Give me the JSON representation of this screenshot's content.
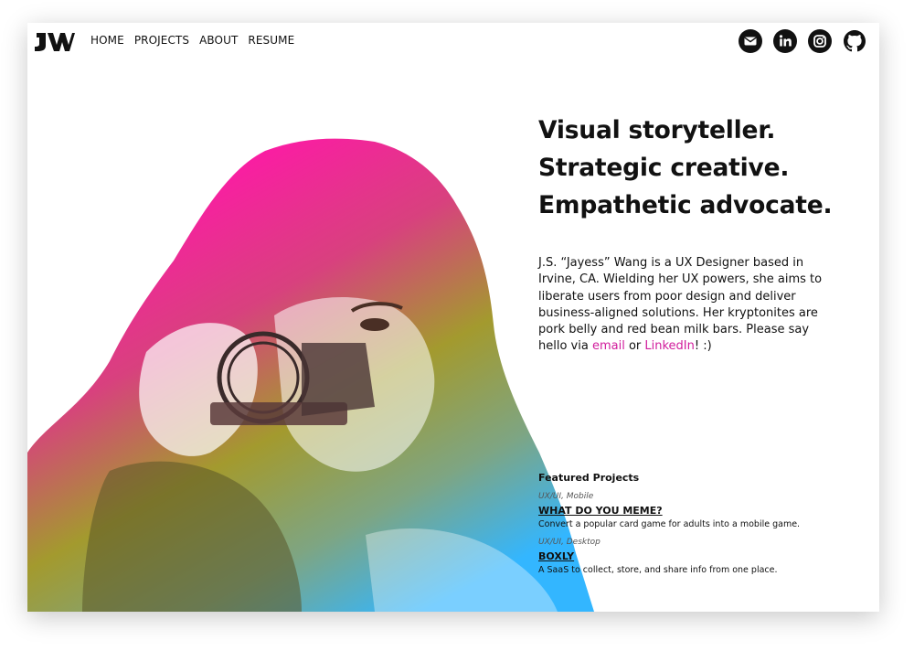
{
  "header": {
    "nav": [
      "HOME",
      "PROJECTS",
      "ABOUT",
      "RESUME"
    ],
    "social_icons": [
      "email-icon",
      "linkedin-icon",
      "instagram-icon",
      "github-icon"
    ]
  },
  "hero": {
    "headline": [
      "Visual storyteller.",
      "Strategic creative.",
      "Empathetic advocate."
    ],
    "bio_text": "J.S. “Jayess” Wang is a UX Designer based in Irvine, CA. Wielding her UX powers, she aims to liberate users from poor design and deliver business-aligned solutions. Her kryptonites are pork belly and red bean milk bars. Please say hello via ",
    "bio_link_email": "email",
    "bio_or": " or ",
    "bio_link_linkedin": "LinkedIn",
    "bio_end": "! :)"
  },
  "featured": {
    "heading": "Featured Projects",
    "projects": [
      {
        "tag": "UX/UI, Mobile",
        "title": "WHAT DO YOU MEME?",
        "desc": "Convert a popular card game for adults into a mobile game."
      },
      {
        "tag": "UX/UI, Desktop",
        "title": "BOXLY",
        "desc": "A SaaS to collect, store, and share info from one place."
      }
    ]
  },
  "colors": {
    "accent": "#d11c9c",
    "gradient": [
      "#ff1aa6",
      "#d4567a",
      "#a8a234",
      "#6aa3b0",
      "#3ab2ff"
    ]
  }
}
